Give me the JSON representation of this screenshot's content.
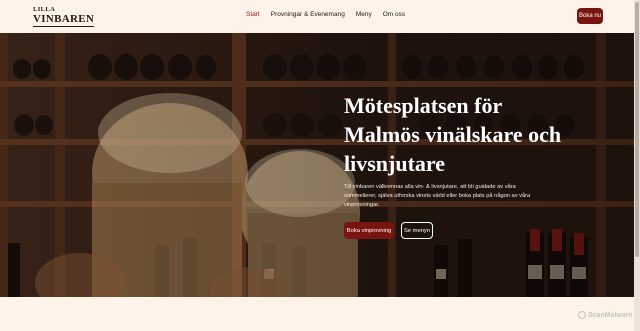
{
  "header": {
    "logo_top": "LILLA",
    "logo_main": "VINBAREN",
    "nav": [
      {
        "label": "Start",
        "active": true
      },
      {
        "label": "Provningar & Evenemang",
        "active": false
      },
      {
        "label": "Meny",
        "active": false
      },
      {
        "label": "Om oss",
        "active": false
      }
    ],
    "cta_label": "Boka nu"
  },
  "hero": {
    "title": "Mötesplatsen för Malmös vinälskare och livsnjutare",
    "text": "Till vinbaren välkomnas alla vin- & livsnjutare, att bli guidade av våra sommelierer, själva utforska vinets värld eller boka plats på någon av våra vinprovningar.",
    "primary_button": "Boka vinprovning",
    "secondary_button": "Se menyn"
  },
  "watermark": "ScanMalware",
  "colors": {
    "accent": "#7a1410",
    "background": "#fdf3e8",
    "nav_active": "#8a1a16"
  }
}
